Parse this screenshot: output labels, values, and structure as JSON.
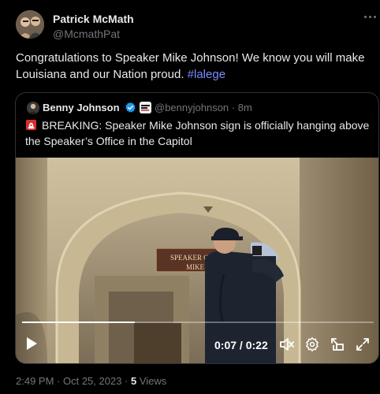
{
  "tweet": {
    "author_name": "Patrick McMath",
    "author_handle": "@McmathPat",
    "text": "Congratulations to Speaker Mike Johnson! We know you will make Louisiana and our Nation proud. ",
    "hashtag": "#lalege"
  },
  "quote": {
    "author_name": "Benny Johnson",
    "author_handle": "@bennyjohnson",
    "separator": "·",
    "time_ago": "8m",
    "text": "BREAKING: Speaker Mike Johnson sign is officially hanging above the Speaker’s Office in the Capitol",
    "sign_line1": "SPEAKER OF",
    "sign_line2": "MIKE"
  },
  "video": {
    "current_time": "0:07",
    "duration": "0:22",
    "time_separator": " / ",
    "progress": 0.32
  },
  "footer": {
    "time": "2:49 PM",
    "sep1": " · ",
    "date": "Oct 25, 2023",
    "sep2": " · ",
    "views_count": "5",
    "views_label": " Views"
  },
  "colors": {
    "background": "#000000",
    "text": "#e7e9ea",
    "muted": "#71767b",
    "hashtag": "#7a8cff",
    "verified": "#1d9bf0"
  },
  "icons": {
    "more": "more-horizontal-icon",
    "verified": "verified-badge-icon",
    "siren": "rotating-light-icon",
    "play": "play-icon",
    "mute": "mute-icon",
    "settings": "gear-icon",
    "popout": "popout-icon",
    "fullscreen": "fullscreen-icon"
  }
}
